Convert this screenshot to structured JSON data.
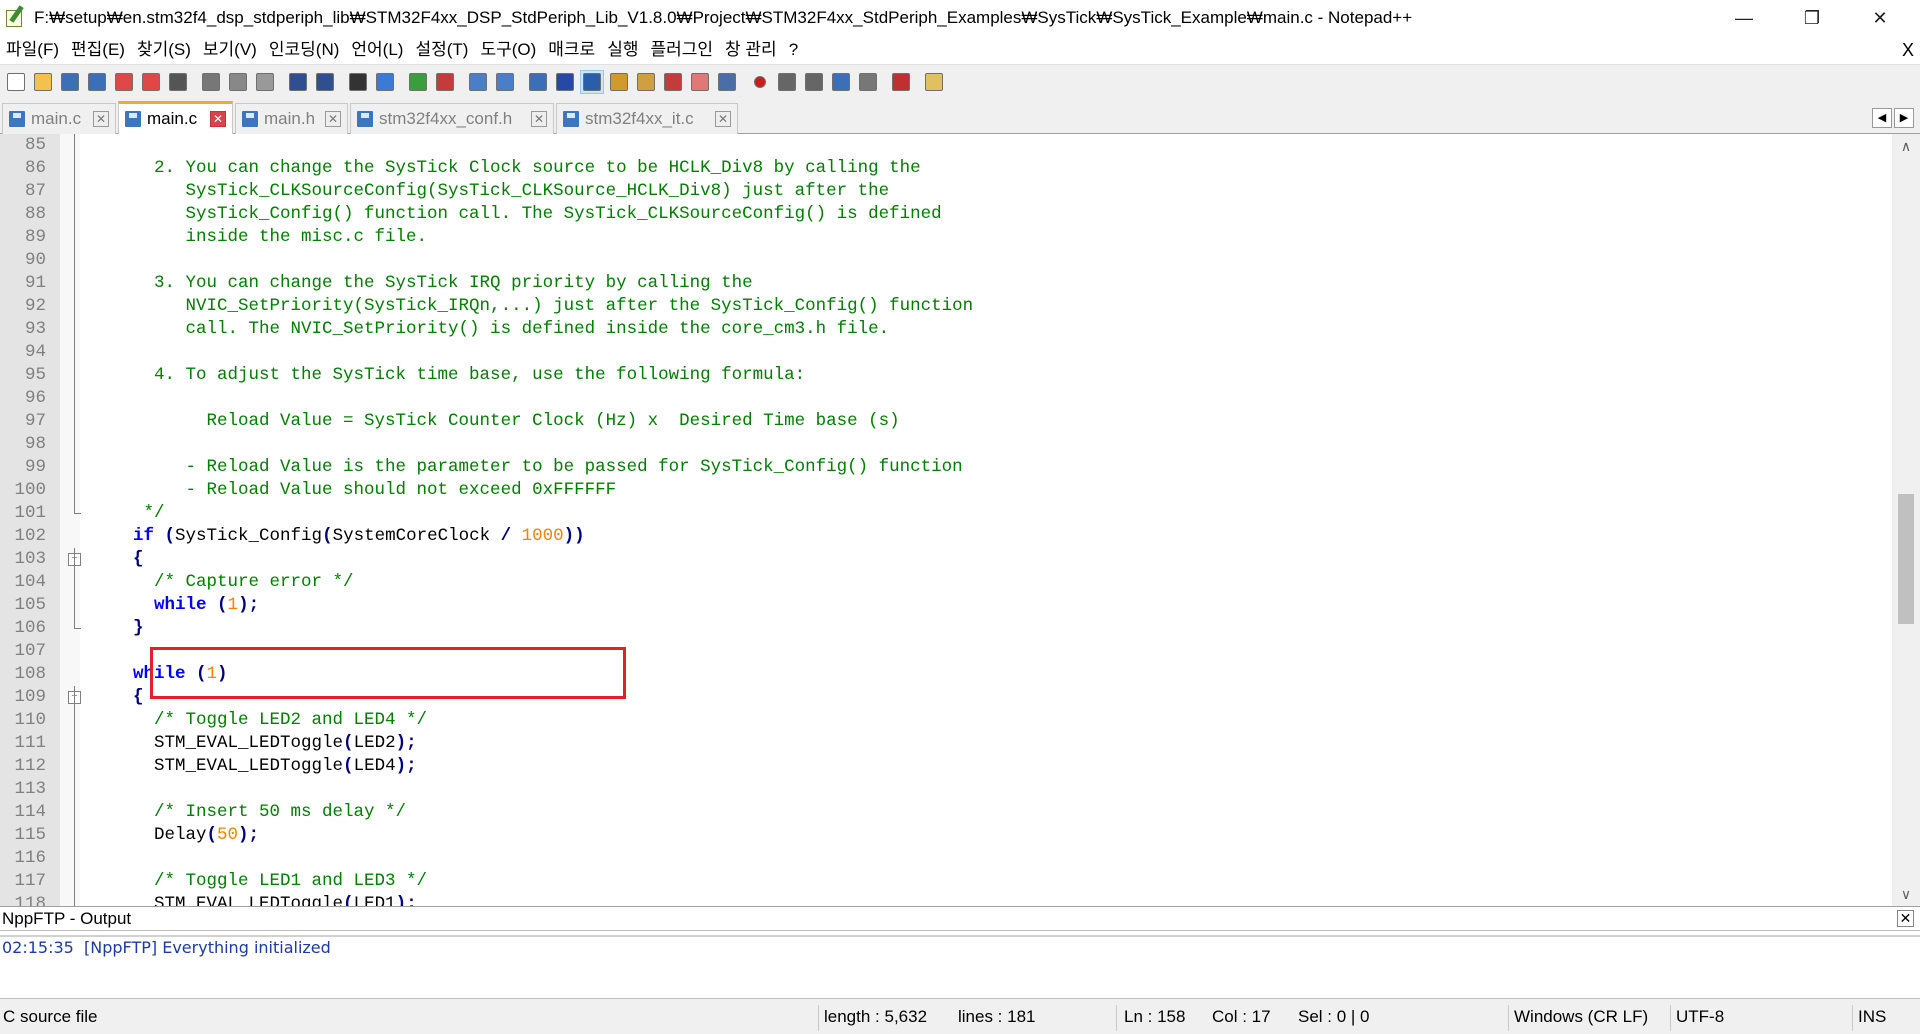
{
  "window": {
    "title": "F:₩setup₩en.stm32f4_dsp_stdperiph_lib₩STM32F4xx_DSP_StdPeriph_Lib_V1.8.0₩Project₩STM32F4xx_StdPeriph_Examples₩SysTick₩SysTick_Example₩main.c - Notepad++",
    "minimize": "—",
    "restore": "❐",
    "close": "✕"
  },
  "menu": {
    "items": [
      "파일(F)",
      "편집(E)",
      "찾기(S)",
      "보기(V)",
      "인코딩(N)",
      "언어(L)",
      "설정(T)",
      "도구(O)",
      "매크로",
      "실행",
      "플러그인",
      "창 관리",
      "?"
    ],
    "close_doc": "X"
  },
  "toolbar": {
    "icons": [
      "new-file-icon",
      "open-file-icon",
      "save-icon",
      "save-all-icon",
      "close-icon",
      "close-all-icon",
      "print-icon",
      "cut-icon",
      "copy-icon",
      "paste-icon",
      "undo-icon",
      "redo-icon",
      "find-icon",
      "replace-icon",
      "zoom-in-icon",
      "zoom-out-icon",
      "sync-vertical-icon",
      "sync-horizontal-icon",
      "word-wrap-icon",
      "show-all-chars-icon",
      "indent-guide-icon",
      "user-language-icon",
      "document-map-icon",
      "function-list-icon",
      "folder-workspace-icon",
      "monitoring-icon",
      "record-macro-icon",
      "stop-record-icon",
      "play-macro-icon",
      "run-macro-multiple-icon",
      "save-macro-icon",
      "spell-check-icon",
      "nppftp-icon"
    ],
    "colors": [
      "#ffffff",
      "#f2c14e",
      "#3b6fb6",
      "#3b6fb6",
      "#e04848",
      "#e04848",
      "#555555",
      "#777777",
      "#888888",
      "#999999",
      "#2f4f8f",
      "#2f4f8f",
      "#333333",
      "#3c7ad6",
      "#3b9e3b",
      "#c33b3b",
      "#4a7fc8",
      "#4a7fc8",
      "#3b6fb6",
      "#2848a8",
      "#2b5ea8",
      "#d09a2c",
      "#d0a040",
      "#c33b3b",
      "#e07878",
      "#4a6fa8",
      "#c81e1e",
      "#666666",
      "#666666",
      "#3b6fb6",
      "#777777",
      "#c03030",
      "#e0c060"
    ]
  },
  "tabs": [
    {
      "label": "main.c",
      "active": false
    },
    {
      "label": "main.c",
      "active": true
    },
    {
      "label": "main.h",
      "active": false
    },
    {
      "label": "stm32f4xx_conf.h",
      "active": false
    },
    {
      "label": "stm32f4xx_it.c",
      "active": false
    }
  ],
  "tab_close_glyph": "✕",
  "tab_scroll": {
    "left": "◀",
    "right": "▶"
  },
  "editor": {
    "lines": [
      {
        "n": "85",
        "segs": []
      },
      {
        "n": "86",
        "segs": [
          {
            "c": "cmt",
            "t": "    2. You can change the SysTick Clock source to be HCLK_Div8 by calling the"
          }
        ]
      },
      {
        "n": "87",
        "segs": [
          {
            "c": "cmt",
            "t": "       SysTick_CLKSourceConfig(SysTick_CLKSource_HCLK_Div8) just after the"
          }
        ]
      },
      {
        "n": "88",
        "segs": [
          {
            "c": "cmt",
            "t": "       SysTick_Config() function call. The SysTick_CLKSourceConfig() is defined"
          }
        ]
      },
      {
        "n": "89",
        "segs": [
          {
            "c": "cmt",
            "t": "       inside the misc.c file."
          }
        ]
      },
      {
        "n": "90",
        "segs": []
      },
      {
        "n": "91",
        "segs": [
          {
            "c": "cmt",
            "t": "    3. You can change the SysTick IRQ priority by calling the"
          }
        ]
      },
      {
        "n": "92",
        "segs": [
          {
            "c": "cmt",
            "t": "       NVIC_SetPriority(SysTick_IRQn,...) just after the SysTick_Config() function"
          }
        ]
      },
      {
        "n": "93",
        "segs": [
          {
            "c": "cmt",
            "t": "       call. The NVIC_SetPriority() is defined inside the core_cm3.h file."
          }
        ]
      },
      {
        "n": "94",
        "segs": []
      },
      {
        "n": "95",
        "segs": [
          {
            "c": "cmt",
            "t": "    4. To adjust the SysTick time base, use the following formula:"
          }
        ]
      },
      {
        "n": "96",
        "segs": []
      },
      {
        "n": "97",
        "segs": [
          {
            "c": "cmt",
            "t": "         Reload Value = SysTick Counter Clock (Hz) x  Desired Time base (s)"
          }
        ]
      },
      {
        "n": "98",
        "segs": []
      },
      {
        "n": "99",
        "segs": [
          {
            "c": "cmt",
            "t": "       - Reload Value is the parameter to be passed for SysTick_Config() function"
          }
        ]
      },
      {
        "n": "100",
        "segs": [
          {
            "c": "cmt",
            "t": "       - Reload Value should not exceed 0xFFFFFF"
          }
        ]
      },
      {
        "n": "101",
        "segs": [
          {
            "c": "cmt",
            "t": "   */"
          }
        ]
      },
      {
        "n": "102",
        "segs": [
          {
            "c": "kw",
            "t": "  if "
          },
          {
            "c": "op",
            "t": "("
          },
          {
            "c": "id",
            "t": "SysTick_Config"
          },
          {
            "c": "op",
            "t": "("
          },
          {
            "c": "id",
            "t": "SystemCoreClock "
          },
          {
            "c": "op",
            "t": "/ "
          },
          {
            "c": "num",
            "t": "1000"
          },
          {
            "c": "op",
            "t": "))"
          }
        ]
      },
      {
        "n": "103",
        "segs": [
          {
            "c": "op",
            "t": "  {"
          }
        ]
      },
      {
        "n": "104",
        "segs": [
          {
            "c": "cmt",
            "t": "    /* Capture error */"
          }
        ]
      },
      {
        "n": "105",
        "segs": [
          {
            "c": "kw",
            "t": "    while "
          },
          {
            "c": "op",
            "t": "("
          },
          {
            "c": "num",
            "t": "1"
          },
          {
            "c": "op",
            "t": ");"
          }
        ]
      },
      {
        "n": "106",
        "segs": [
          {
            "c": "op",
            "t": "  }"
          }
        ]
      },
      {
        "n": "107",
        "segs": []
      },
      {
        "n": "108",
        "segs": [
          {
            "c": "kw",
            "t": "  while "
          },
          {
            "c": "op",
            "t": "("
          },
          {
            "c": "num",
            "t": "1"
          },
          {
            "c": "op",
            "t": ")"
          }
        ]
      },
      {
        "n": "109",
        "segs": [
          {
            "c": "op",
            "t": "  {"
          }
        ]
      },
      {
        "n": "110",
        "segs": [
          {
            "c": "cmt",
            "t": "    /* Toggle LED2 and LED4 */"
          }
        ]
      },
      {
        "n": "111",
        "segs": [
          {
            "c": "id",
            "t": "    STM_EVAL_LEDToggle"
          },
          {
            "c": "op",
            "t": "("
          },
          {
            "c": "id",
            "t": "LED2"
          },
          {
            "c": "op",
            "t": ");"
          }
        ]
      },
      {
        "n": "112",
        "segs": [
          {
            "c": "id",
            "t": "    STM_EVAL_LEDToggle"
          },
          {
            "c": "op",
            "t": "("
          },
          {
            "c": "id",
            "t": "LED4"
          },
          {
            "c": "op",
            "t": ");"
          }
        ]
      },
      {
        "n": "113",
        "segs": []
      },
      {
        "n": "114",
        "segs": [
          {
            "c": "cmt",
            "t": "    /* Insert 50 ms delay */"
          }
        ]
      },
      {
        "n": "115",
        "segs": [
          {
            "c": "id",
            "t": "    Delay"
          },
          {
            "c": "op",
            "t": "("
          },
          {
            "c": "num",
            "t": "50"
          },
          {
            "c": "op",
            "t": ");"
          }
        ]
      },
      {
        "n": "116",
        "segs": []
      },
      {
        "n": "117",
        "segs": [
          {
            "c": "cmt",
            "t": "    /* Toggle LED1 and LED3 */"
          }
        ]
      },
      {
        "n": "118",
        "segs": [
          {
            "c": "id",
            "t": "    STM_EVAL_LEDToggle"
          },
          {
            "c": "op",
            "t": "("
          },
          {
            "c": "id",
            "t": "LED1"
          },
          {
            "c": "op",
            "t": ");"
          }
        ]
      }
    ],
    "fold_markers": {
      "open": "−"
    }
  },
  "scrollbar": {
    "up": "∧",
    "down": "∨"
  },
  "output": {
    "title": "NppFTP - Output",
    "close": "✕",
    "lines": [
      "02:15:35  [NppFTP] Everything initialized"
    ]
  },
  "status": {
    "type": "C source file",
    "length": "length : 5,632",
    "lines": "lines : 181",
    "ln": "Ln : 158",
    "col": "Col : 17",
    "sel": "Sel : 0 | 0",
    "eol": "Windows (CR LF)",
    "encoding": "UTF-8",
    "mode": "INS"
  }
}
